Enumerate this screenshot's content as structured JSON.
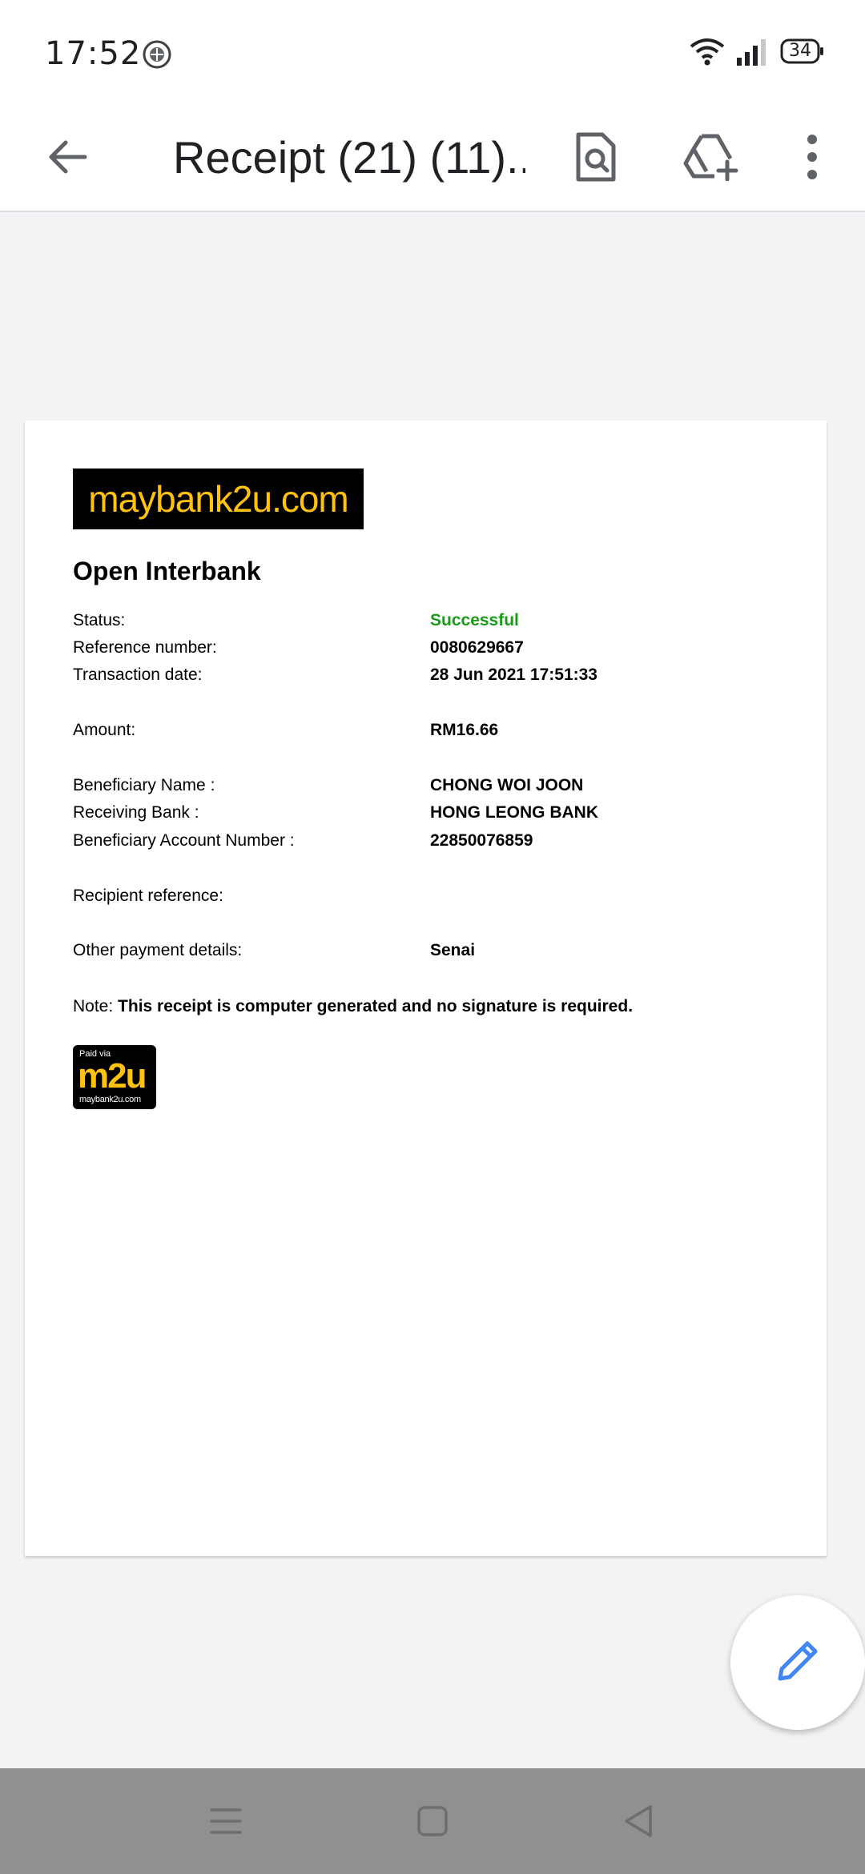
{
  "status_bar": {
    "time": "17:52",
    "battery": "34"
  },
  "toolbar": {
    "title": "Receipt (21) (11)....",
    "back_icon": "arrow-back-icon",
    "find_icon": "find-in-page-icon",
    "drive_icon": "add-to-drive-icon",
    "more_icon": "more-vert-icon"
  },
  "document": {
    "logo_text": "maybank2u.com",
    "heading": "Open Interbank",
    "rows": [
      {
        "label": "Status:",
        "value": "Successful"
      },
      {
        "label": "Reference number:",
        "value": "0080629667"
      },
      {
        "label": "Transaction date:",
        "value": "28 Jun 2021 17:51:33"
      },
      {
        "label": "Amount:",
        "value": "RM16.66"
      },
      {
        "label": "Beneficiary Name :",
        "value": "CHONG WOI JOON"
      },
      {
        "label": "Receiving Bank :",
        "value": "HONG LEONG BANK"
      },
      {
        "label": "Beneficiary Account Number :",
        "value": "22850076859"
      },
      {
        "label": "Recipient reference:",
        "value": ""
      },
      {
        "label": "Other payment details:",
        "value": "Senai"
      }
    ],
    "note_label": "Note:",
    "note_text": "This receipt is computer generated and no signature is required.",
    "badge": {
      "paid_via": "Paid via",
      "brand": "m2u",
      "site": "maybank2u.com"
    }
  },
  "fab": {
    "icon": "edit-pencil-icon"
  },
  "colors": {
    "accent": "#4285f4",
    "success": "#1a9b1a",
    "brand_yellow": "#ffc20e"
  }
}
